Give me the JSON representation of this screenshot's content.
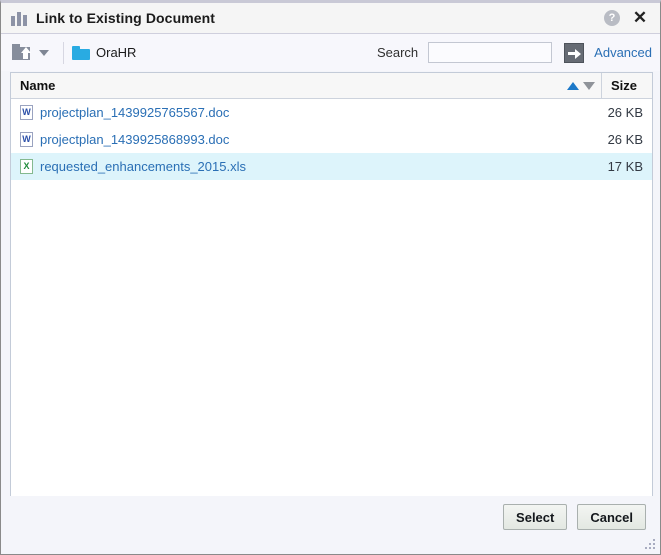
{
  "window": {
    "title": "Link to Existing Document",
    "icon": "document-library-icon",
    "help_label": "?",
    "close_label": "✕"
  },
  "toolbar": {
    "upload_icon": "upload-folder-icon",
    "dropdown_icon": "chevron-down-icon",
    "folder_icon": "folder-icon",
    "folder_name": "OraHR",
    "search_label": "Search",
    "search_value": "",
    "search_placeholder": "",
    "search_go_icon": "arrow-right-icon",
    "advanced_label": "Advanced"
  },
  "table": {
    "columns": {
      "name": "Name",
      "size": "Size"
    },
    "sort": {
      "ascending_icon": "sort-ascending-icon",
      "descending_icon": "sort-descending-icon",
      "active": "ascending"
    },
    "rows": [
      {
        "icon": "word-document-icon",
        "type": "doc",
        "badge": "W",
        "name": "projectplan_1439925765567.doc",
        "size": "26 KB",
        "selected": false
      },
      {
        "icon": "word-document-icon",
        "type": "doc",
        "badge": "W",
        "name": "projectplan_1439925868993.doc",
        "size": "26 KB",
        "selected": false
      },
      {
        "icon": "excel-document-icon",
        "type": "xls",
        "badge": "X",
        "name": "requested_enhancements_2015.xls",
        "size": "17 KB",
        "selected": true
      }
    ]
  },
  "footer": {
    "select_label": "Select",
    "cancel_label": "Cancel",
    "resize_icon": "resize-grip-icon"
  },
  "colors": {
    "link": "#2a6fb5",
    "selection": "#ddf4fb",
    "sort_active": "#1c78c8",
    "folder": "#29abe2"
  }
}
